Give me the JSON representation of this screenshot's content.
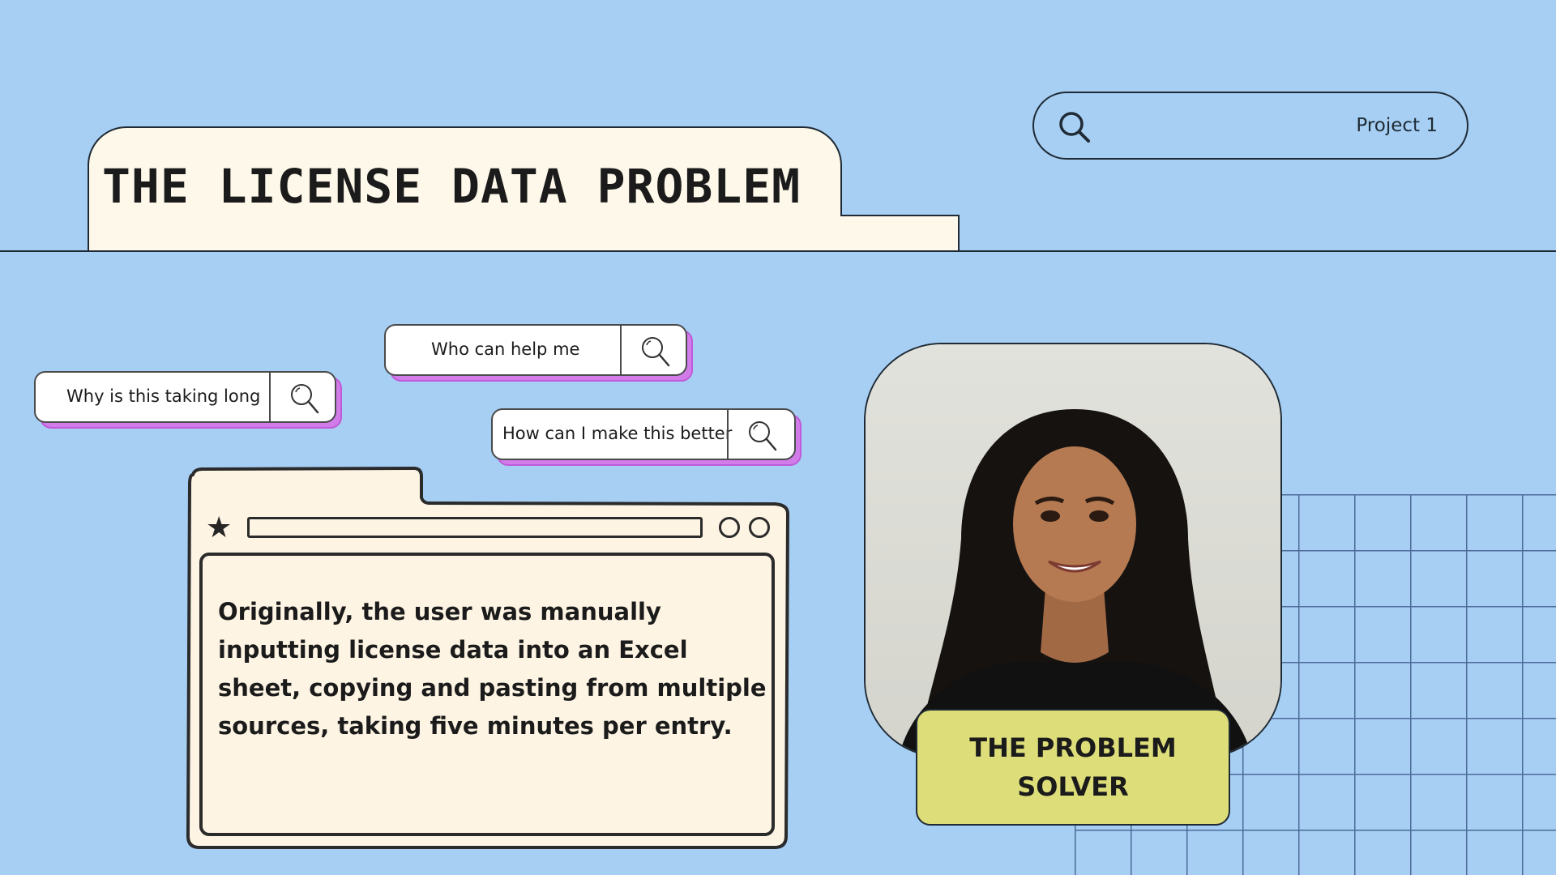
{
  "header": {
    "title": "THE LICENSE DATA PROBLEM",
    "search_label": "Project 1",
    "search_icon": "search-icon"
  },
  "chips": [
    {
      "label": "Why is this taking long",
      "icon": "magnifier-icon"
    },
    {
      "label": "Who can help me",
      "icon": "magnifier-icon"
    },
    {
      "label": "How can I make this better",
      "icon": "magnifier-icon"
    }
  ],
  "browser_card": {
    "body": "Originally, the user was manually inputting license data into an Excel sheet, copying and pasting from multiple sources, taking five minutes per entry.",
    "star_icon": "star-icon"
  },
  "profile": {
    "tag": "THE PROBLEM SOLVER",
    "photo": "portrait-photo"
  },
  "colors": {
    "background": "#a6cff3",
    "cream": "#fdf8e9",
    "chip_shadow": "#d17ce9",
    "tag": "#dddd79",
    "ink": "#1f2a35"
  }
}
